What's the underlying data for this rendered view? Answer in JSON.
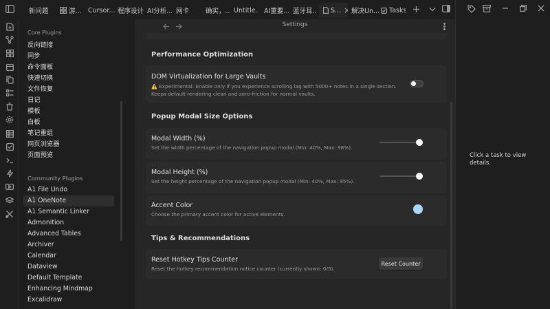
{
  "tabs": [
    {
      "label": "新问题"
    },
    {
      "label": "游..."
    },
    {
      "label": "Cursor..."
    },
    {
      "label": "程序设计"
    },
    {
      "label": "AI分析..."
    },
    {
      "label": "网卡"
    },
    {
      "label": "确实，..."
    },
    {
      "label": "Untitle..."
    },
    {
      "label": "AI重要..."
    },
    {
      "label": "蓝牙耳..."
    },
    {
      "label": "S..."
    },
    {
      "label": "解决Un..."
    },
    {
      "label": "Tasks"
    }
  ],
  "sidebar": {
    "core_heading": "Core Plugins",
    "core_items": [
      "反向链接",
      "同步",
      "命令面板",
      "快速切换",
      "文件恢复",
      "日记",
      "模板",
      "白板",
      "笔记重组",
      "网页浏览器",
      "页面预览"
    ],
    "community_heading": "Community Plugins",
    "community_items": [
      "A1 File Undo",
      "A1 OneNote",
      "A1 Semantic Linker",
      "Admonition",
      "Advanced Tables",
      "Archiver",
      "Calendar",
      "Dataview",
      "Default Template",
      "Enhancing Mindmap",
      "Excalidraw"
    ],
    "selected": "A1 OneNote"
  },
  "main": {
    "title": "Settings",
    "sections": {
      "performance": "Performance Optimization",
      "popup": "Popup Modal Size Options",
      "tips": "Tips & Recommendations"
    },
    "dom_virtualization": {
      "title": "DOM Virtualization for Large Vaults",
      "warning_icon": "⚠️",
      "desc": "Experimental: Enable only if you experience scrolling lag with 5000+ notes in a single section. Keeps default rendering clean and zero-friction for normal vaults.",
      "enabled": false
    },
    "modal_width": {
      "title": "Modal Width (%)",
      "desc": "Set the width percentage of the navigation popup modal (Min: 40%, Max: 98%).",
      "value_fraction": 1.0
    },
    "modal_height": {
      "title": "Modal Height (%)",
      "desc": "Set the height percentage of the navigation popup modal (Min: 40%, Max: 95%).",
      "value_fraction": 1.0
    },
    "accent_color": {
      "title": "Accent Color",
      "desc": "Choose the primary accent color for active elements.",
      "color": "#a8d8ff"
    },
    "reset_hotkey": {
      "title": "Reset Hotkey Tips Counter",
      "desc": "Reset the hotkey recommendation notice counter (currently shown: 0/5).",
      "button": "Reset Counter"
    }
  },
  "right_panel": {
    "message": "Click a task to view details."
  },
  "icons": [
    "sidebar-toggle-icon",
    "new-tab-icon",
    "tab-list-icon",
    "right-sidebar-icon",
    "back-icon",
    "forward-icon",
    "more-options-icon",
    "tag-icon",
    "archive-icon",
    "minimize-icon",
    "restore-icon",
    "close-icon"
  ]
}
